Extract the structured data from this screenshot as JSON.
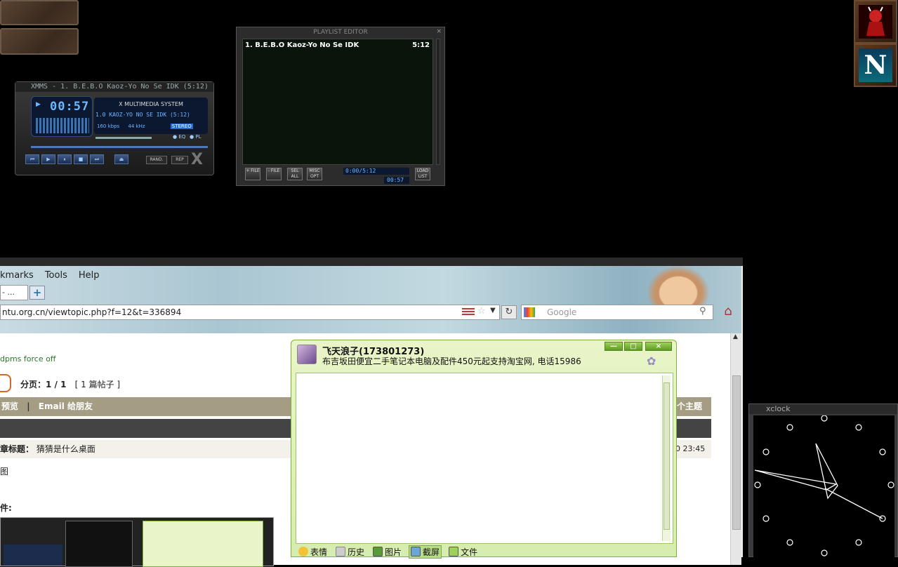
{
  "xmms": {
    "title": "XMMS - 1. B.E.B.O Kaoz-Yo No Se IDK (5:12)",
    "time": "00:57",
    "brand": "X MULTIMEDIA SYSTEM",
    "track": "1.0 KAOZ-YO NO SE IDK (5:12)",
    "bitrate": "160 kbps",
    "freq": "44 kHz",
    "stereo": "STEREO",
    "eq": "EQ",
    "pl": "PL",
    "rand": "RAND.",
    "rep": "REP"
  },
  "playlist": {
    "title": "PLAYLIST EDITOR",
    "item": "1. B.E.B.O Kaoz-Yo No Se IDK",
    "length": "5:12",
    "buttons": [
      "+ FILE",
      "- FILE",
      "SEL ALL",
      "MISC OPT",
      "LOAD LIST"
    ],
    "time_total": "0:00/5:12",
    "time_elapsed": "00:57"
  },
  "browser": {
    "menu": [
      "kmarks",
      "Tools",
      "Help"
    ],
    "tab_label": "- ...",
    "url": "ntu.org.cn/viewtopic.php?f=12&t=336894",
    "search_placeholder": "Google",
    "dpms": "dpms force off",
    "pages": "分页：1 / 1",
    "post_count": "[ 1 篇帖子 ]",
    "head_left": "预览",
    "head_mid": "Email 给朋友",
    "head_right": "个主题",
    "post_title_label": "章标题：",
    "post_title": "猜猜是什么桌面",
    "post_time": "0 23:45",
    "text_tu": "图",
    "attach": "件:"
  },
  "qq": {
    "name": "飞天浪子(173801273)",
    "signature": "布吉坂田便宜二手笔记本电脑及配件450元起支持淘宝网, 电话15986",
    "tools": [
      "表情",
      "历史",
      "图片",
      "截屏",
      "文件"
    ]
  },
  "xclock": {
    "title": "xclock"
  },
  "colors": {
    "qq_green": "#7db03a",
    "lcd_blue": "#6ab8ff"
  }
}
